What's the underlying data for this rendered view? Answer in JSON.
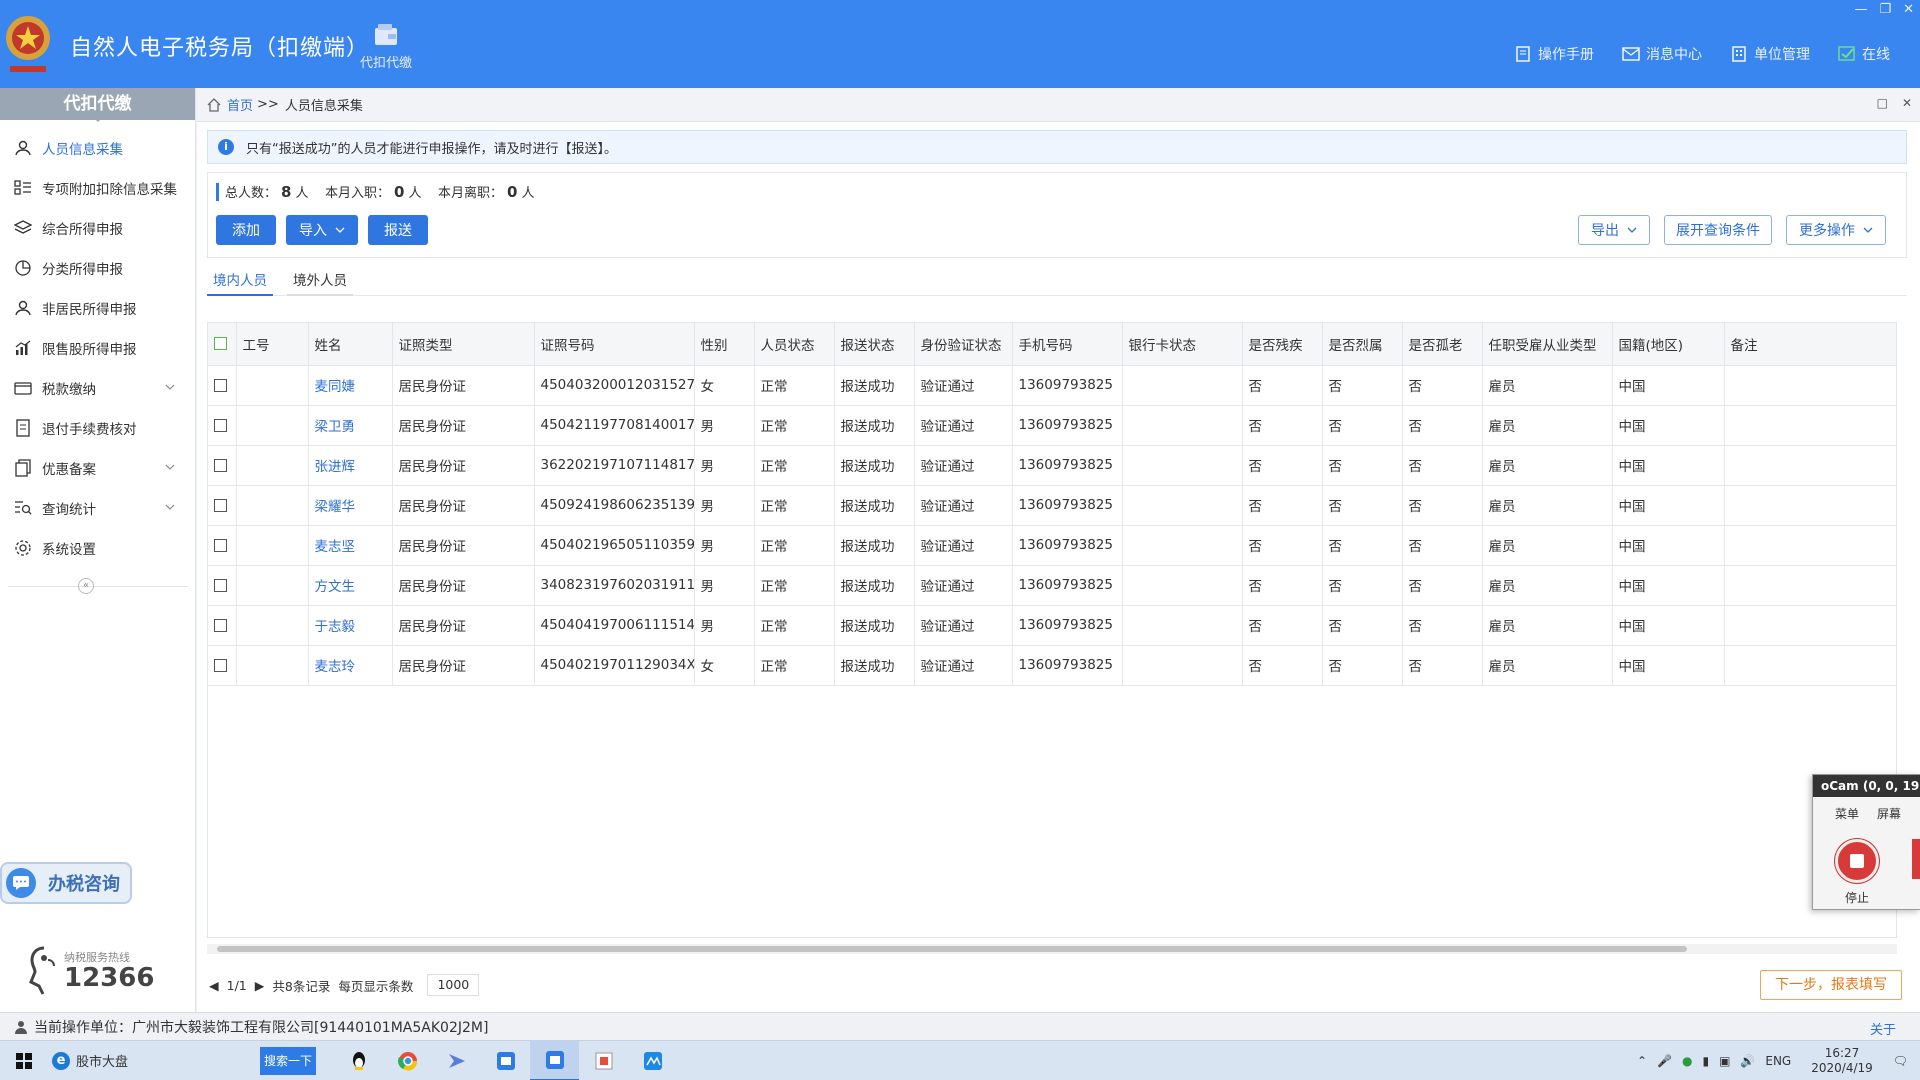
{
  "header": {
    "title": "自然人电子税务局（扣缴端）",
    "tile_label": "代扣代缴",
    "nav": [
      {
        "label": "操作手册",
        "icon": "manual-icon"
      },
      {
        "label": "消息中心",
        "icon": "mail-icon"
      },
      {
        "label": "单位管理",
        "icon": "building-icon"
      },
      {
        "label": "在线",
        "icon": "online-check-icon"
      }
    ]
  },
  "sidebar": {
    "title": "代扣代缴",
    "items": [
      {
        "label": "人员信息采集",
        "icon": "person-icon",
        "active": true
      },
      {
        "label": "专项附加扣除信息采集",
        "icon": "list-icon"
      },
      {
        "label": "综合所得申报",
        "icon": "layers-icon"
      },
      {
        "label": "分类所得申报",
        "icon": "pie-icon"
      },
      {
        "label": "非居民所得申报",
        "icon": "person-icon"
      },
      {
        "label": "限售股所得申报",
        "icon": "bar-chart-icon"
      },
      {
        "label": "税款缴纳",
        "icon": "wallet-icon",
        "chevron": true
      },
      {
        "label": "退付手续费核对",
        "icon": "document-icon"
      },
      {
        "label": "优惠备案",
        "icon": "copy-icon",
        "chevron": true
      },
      {
        "label": "查询统计",
        "icon": "search-list-icon",
        "chevron": true
      },
      {
        "label": "系统设置",
        "icon": "gear-icon"
      }
    ],
    "consult_label": "办税咨询",
    "hotline_label": "纳税服务热线",
    "hotline_number": "12366"
  },
  "breadcrumb": {
    "home": "首页",
    "sep": ">>",
    "current": "人员信息采集"
  },
  "notice": "只有“报送成功”的人员才能进行申报操作，请及时进行【报送】。",
  "stats": {
    "total_label": "总人数：",
    "total": "8",
    "unit": "人",
    "join_label": "本月入职：",
    "join": "0",
    "leave_label": "本月离职：",
    "leave": "0"
  },
  "toolbar": {
    "add": "添加",
    "import": "导入",
    "submit": "报送",
    "export": "导出",
    "expand_query": "展开查询条件",
    "more": "更多操作"
  },
  "tabs": [
    "境内人员",
    "境外人员"
  ],
  "table": {
    "columns": [
      "工号",
      "姓名",
      "证照类型",
      "证照号码",
      "性别",
      "人员状态",
      "报送状态",
      "身份验证状态",
      "手机号码",
      "银行卡状态",
      "是否残疾",
      "是否烈属",
      "是否孤老",
      "任职受雇从业类型",
      "国籍(地区)",
      "备注"
    ],
    "rows": [
      [
        "",
        "麦同婕",
        "居民身份证",
        "450403200012031527",
        "女",
        "正常",
        "报送成功",
        "验证通过",
        "13609793825",
        "",
        "否",
        "否",
        "否",
        "雇员",
        "中国",
        ""
      ],
      [
        "",
        "梁卫勇",
        "居民身份证",
        "450421197708140017",
        "男",
        "正常",
        "报送成功",
        "验证通过",
        "13609793825",
        "",
        "否",
        "否",
        "否",
        "雇员",
        "中国",
        ""
      ],
      [
        "",
        "张进辉",
        "居民身份证",
        "362202197107114817",
        "男",
        "正常",
        "报送成功",
        "验证通过",
        "13609793825",
        "",
        "否",
        "否",
        "否",
        "雇员",
        "中国",
        ""
      ],
      [
        "",
        "梁耀华",
        "居民身份证",
        "450924198606235139",
        "男",
        "正常",
        "报送成功",
        "验证通过",
        "13609793825",
        "",
        "否",
        "否",
        "否",
        "雇员",
        "中国",
        ""
      ],
      [
        "",
        "麦志坚",
        "居民身份证",
        "450402196505110359",
        "男",
        "正常",
        "报送成功",
        "验证通过",
        "13609793825",
        "",
        "否",
        "否",
        "否",
        "雇员",
        "中国",
        ""
      ],
      [
        "",
        "方文生",
        "居民身份证",
        "340823197602031911",
        "男",
        "正常",
        "报送成功",
        "验证通过",
        "13609793825",
        "",
        "否",
        "否",
        "否",
        "雇员",
        "中国",
        ""
      ],
      [
        "",
        "于志毅",
        "居民身份证",
        "450404197006111514",
        "男",
        "正常",
        "报送成功",
        "验证通过",
        "13609793825",
        "",
        "否",
        "否",
        "否",
        "雇员",
        "中国",
        ""
      ],
      [
        "",
        "麦志玲",
        "居民身份证",
        "45040219701129034X",
        "女",
        "正常",
        "报送成功",
        "验证通过",
        "13609793825",
        "",
        "否",
        "否",
        "否",
        "雇员",
        "中国",
        ""
      ]
    ]
  },
  "pager": {
    "page": "1/1",
    "total": "共8条记录",
    "size_label": "每页显示条数",
    "size": "1000"
  },
  "next_button": "下一步，报表填写",
  "status_bar": {
    "company": "当前操作单位：广州市大毅装饰工程有限公司[91440101MA5AK02J2M]",
    "close": "关于"
  },
  "ocam": {
    "title": "oCam (0, 0, 19",
    "menu": "菜单",
    "screen": "屏幕",
    "stop": "停止"
  },
  "taskbar": {
    "search_text": "股市大盘",
    "search_button": "搜索一下",
    "lang": "ENG",
    "time": "16:27",
    "date": "2020/4/19"
  },
  "colors": {
    "header": "#3a86f0",
    "accent": "#2f6fd8",
    "next_button": "#e47a14"
  }
}
